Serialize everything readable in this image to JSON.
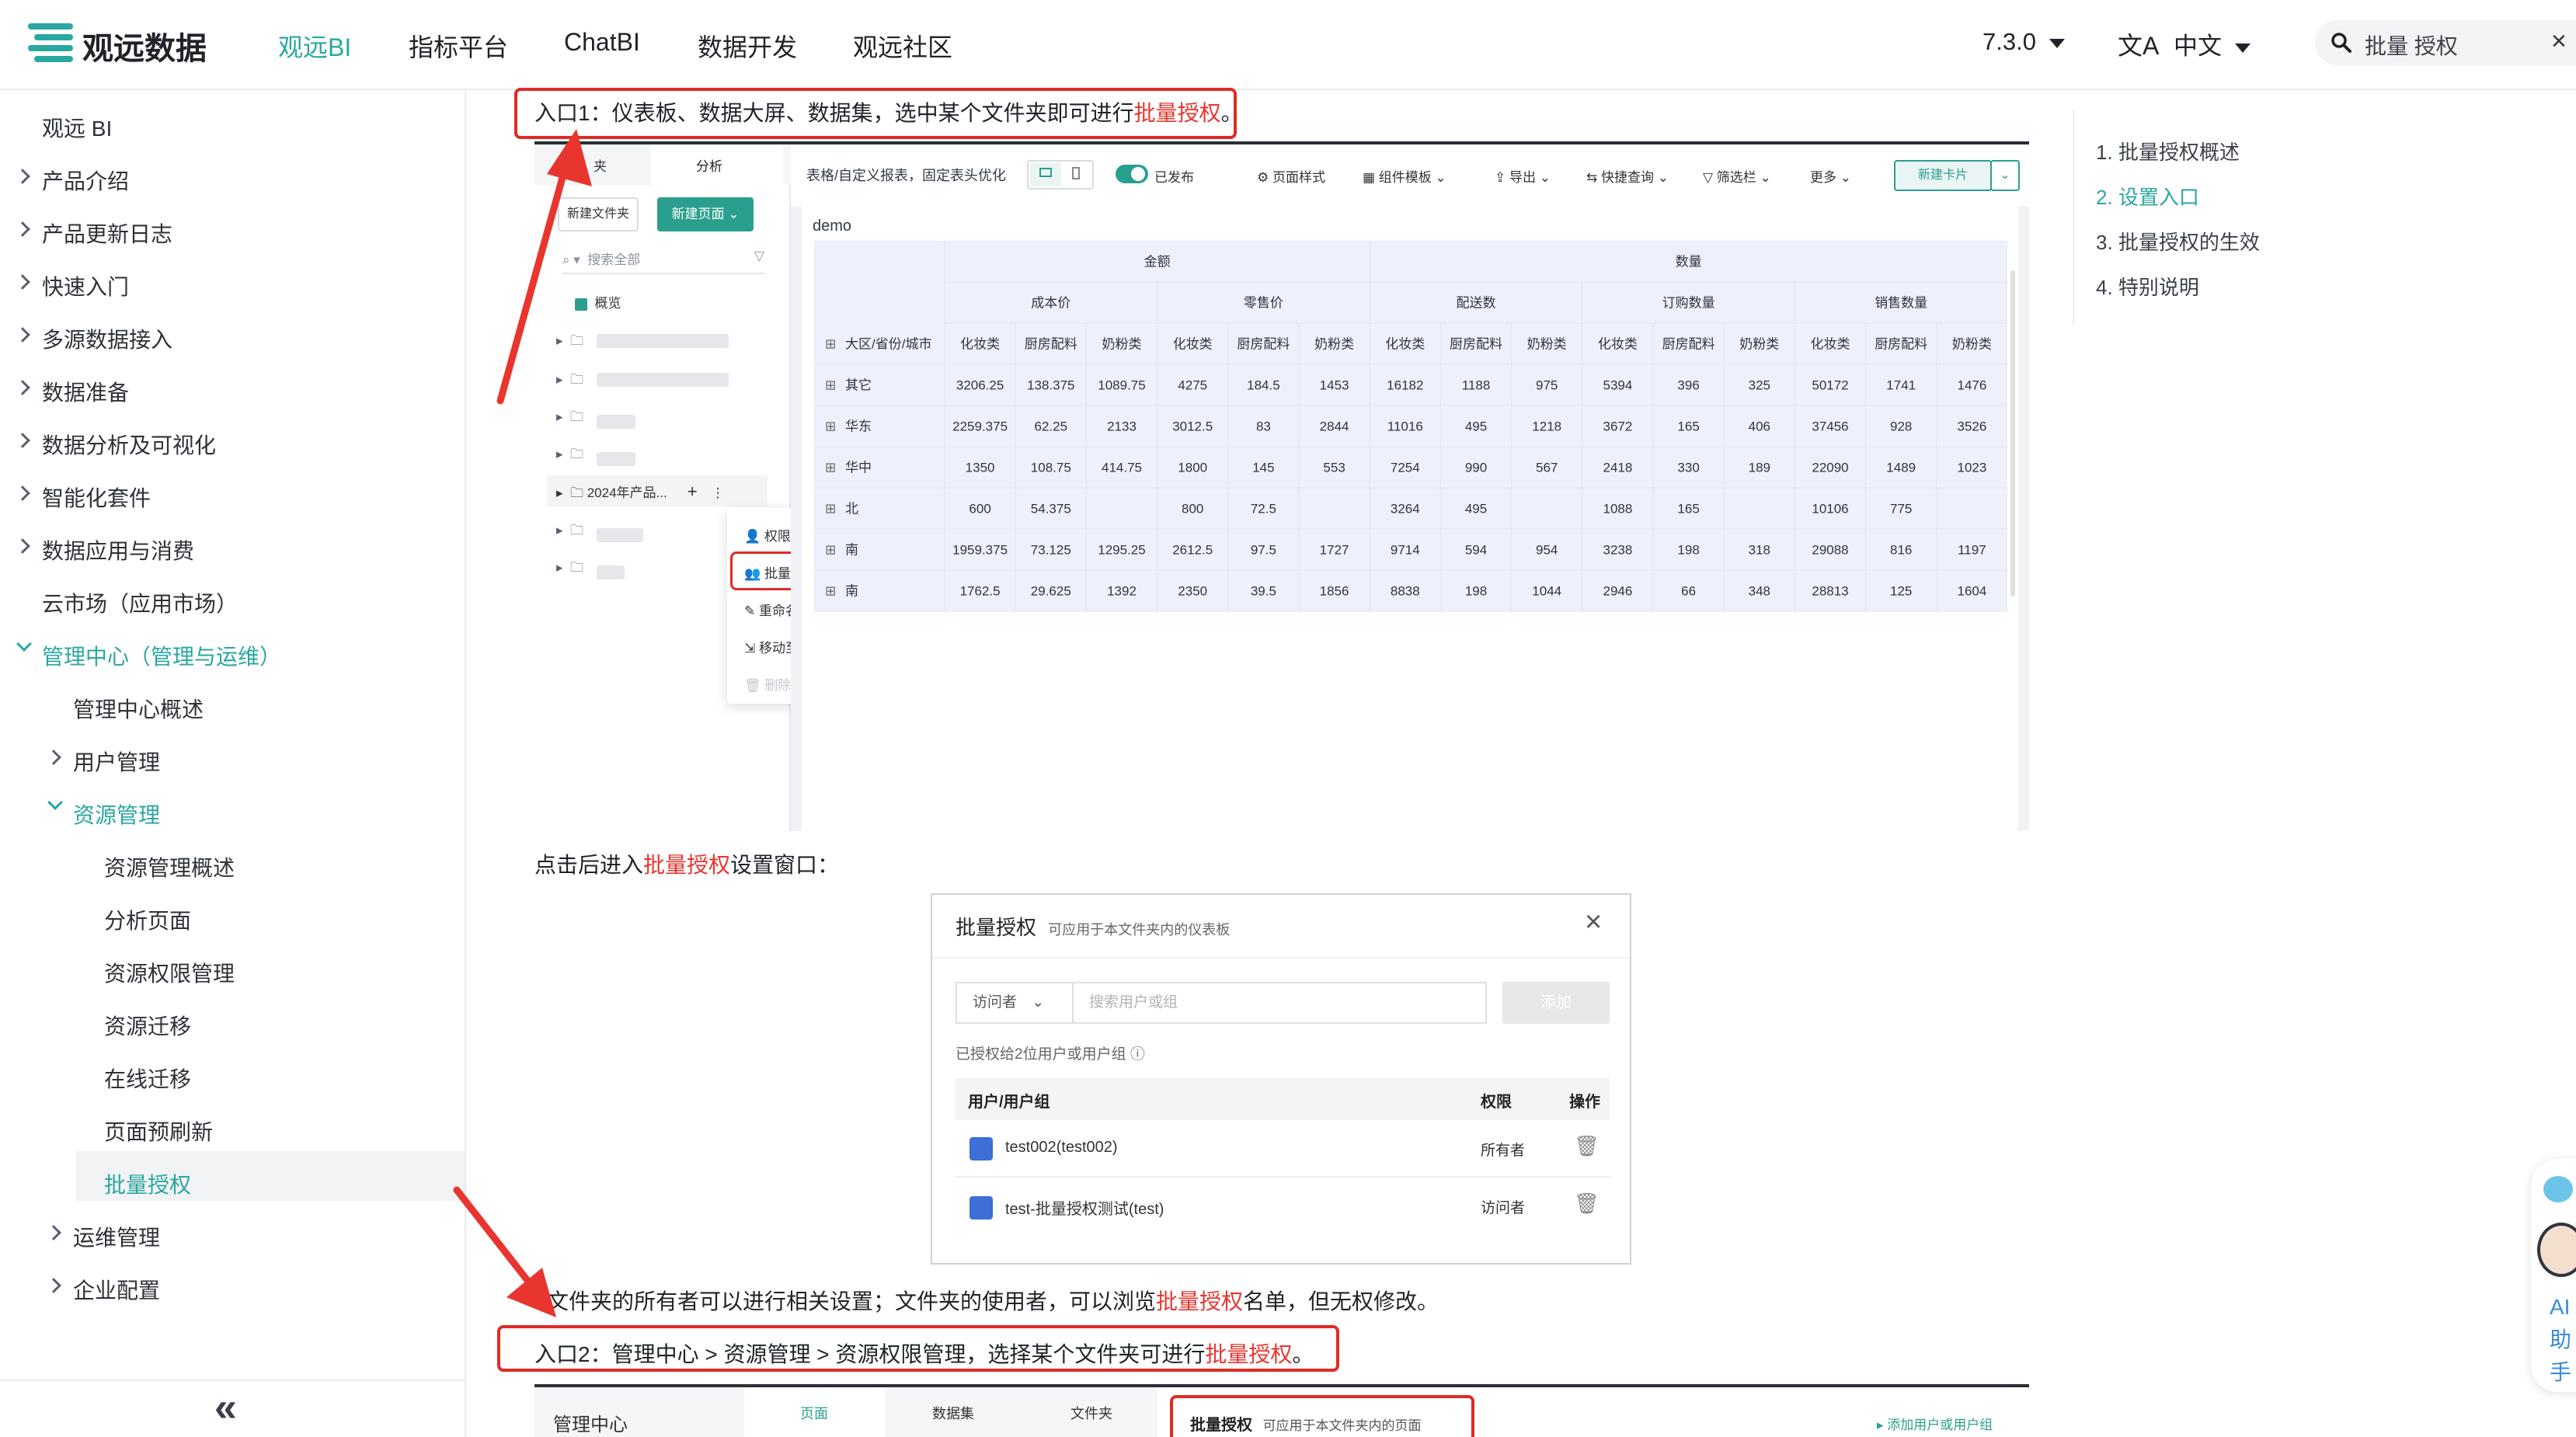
{
  "nav": {
    "logo": "观远数据",
    "links": [
      "观远BI",
      "指标平台",
      "ChatBI",
      "数据开发",
      "观远社区"
    ],
    "version": "7.3.0",
    "lang": "中文",
    "search": "批量 授权"
  },
  "sidebar": {
    "items": [
      "观远 BI",
      "产品介绍",
      "产品更新日志",
      "快速入门",
      "多源数据接入",
      "数据准备",
      "数据分析及可视化",
      "智能化套件",
      "数据应用与消费",
      "云市场（应用市场）",
      "管理中心（管理与运维）",
      "管理中心概述",
      "用户管理",
      "资源管理",
      "资源管理概述",
      "分析页面",
      "资源权限管理",
      "资源迁移",
      "在线迁移",
      "页面预刷新",
      "批量授权",
      "运维管理",
      "企业配置"
    ],
    "collapse": "«"
  },
  "toc": [
    "1. 批量授权概述",
    "2. 设置入口",
    "3. 批量授权的生效",
    "4. 特别说明"
  ],
  "content": {
    "entry1": [
      "入口1：仪表板、数据大屏、数据集，选中某个文件夹即可进行",
      "批量授权",
      "。"
    ],
    "after_click": [
      "点击后进入",
      "批量授权",
      "设置窗口："
    ],
    "owner_note": [
      "文件夹的所有者可以进行相关设置；文件夹的使用者，可以浏览",
      "批量授权",
      "名单，但无权修改。"
    ],
    "entry2": [
      "入口2：管理中心 > 资源管理 > 资源权限管理，选择某个文件夹可进行",
      "批量授权",
      "。"
    ]
  },
  "shot1": {
    "tabs": [
      "夹",
      "分析"
    ],
    "new_folder": "新建文件夹",
    "new_page": "新建页面",
    "search_all": "搜索全部",
    "overview": "概览",
    "folder": "2024年产品...",
    "menu": [
      "权限管理",
      "批量授权",
      "重命名",
      "移动至",
      "删除"
    ],
    "toolbar": {
      "title": "表格/自定义报表，固定表头优化",
      "published": "已发布",
      "items": [
        "页面样式",
        "组件模板",
        "导出",
        "快捷查询",
        "筛选栏",
        "更多"
      ],
      "new_card": "新建卡片"
    },
    "card_title": "demo",
    "table": {
      "group1": "金额",
      "group2": "数量",
      "sub": [
        "成本价",
        "零售价",
        "配送数",
        "订购数量",
        "销售数量"
      ],
      "dim": "大区/省份/城市",
      "cols": [
        "化妆类",
        "厨房配料",
        "奶粉类",
        "化妆类",
        "厨房配料",
        "奶粉类",
        "化妆类",
        "厨房配料",
        "奶粉类",
        "化妆类",
        "厨房配料",
        "奶粉类",
        "化妆类",
        "厨房配料",
        "奶粉类"
      ],
      "rows": [
        {
          "name": "其它",
          "v": [
            "3206.25",
            "138.375",
            "1089.75",
            "4275",
            "184.5",
            "1453",
            "16182",
            "1188",
            "975",
            "5394",
            "396",
            "325",
            "50172",
            "1741",
            "1476"
          ]
        },
        {
          "name": "华东",
          "v": [
            "2259.375",
            "62.25",
            "2133",
            "3012.5",
            "83",
            "2844",
            "11016",
            "495",
            "1218",
            "3672",
            "165",
            "406",
            "37456",
            "928",
            "3526"
          ]
        },
        {
          "name": "华中",
          "v": [
            "1350",
            "108.75",
            "414.75",
            "1800",
            "145",
            "553",
            "7254",
            "990",
            "567",
            "2418",
            "330",
            "189",
            "22090",
            "1489",
            "1023"
          ]
        },
        {
          "name": "北",
          "v": [
            "600",
            "54.375",
            "",
            "800",
            "72.5",
            "",
            "3264",
            "495",
            "",
            "1088",
            "165",
            "",
            "10106",
            "775",
            ""
          ]
        },
        {
          "name": "南",
          "v": [
            "1959.375",
            "73.125",
            "1295.25",
            "2612.5",
            "97.5",
            "1727",
            "9714",
            "594",
            "954",
            "3238",
            "198",
            "318",
            "29088",
            "816",
            "1197"
          ]
        },
        {
          "name": "南",
          "v": [
            "1762.5",
            "29.625",
            "1392",
            "2350",
            "39.5",
            "1856",
            "8838",
            "198",
            "1044",
            "2946",
            "66",
            "348",
            "28813",
            "125",
            "1604"
          ]
        }
      ]
    }
  },
  "dialog": {
    "title": "批量授权",
    "subtitle": "可应用于本文件夹内的仪表板",
    "role": "访问者",
    "search": "搜索用户或组",
    "add": "添加",
    "count": "已授权给2位用户或用户组",
    "th": [
      "用户/用户组",
      "权限",
      "操作"
    ],
    "rows": [
      {
        "name": "test002(test002)",
        "perm": "所有者"
      },
      {
        "name": "test-批量授权测试(test)",
        "perm": "访问者"
      }
    ]
  },
  "shot2": {
    "admin": "管理中心",
    "tabs": [
      "页面",
      "数据集",
      "文件夹"
    ],
    "title": "批量授权",
    "subtitle": "可应用于本文件夹内的页面",
    "add": "添加用户或用户组"
  },
  "float": {
    "ai": [
      "AI",
      "助",
      "手"
    ]
  },
  "colors": {
    "accent": "#2aa7a0",
    "red": "#e8352e",
    "btn": "#2b9f8e"
  }
}
